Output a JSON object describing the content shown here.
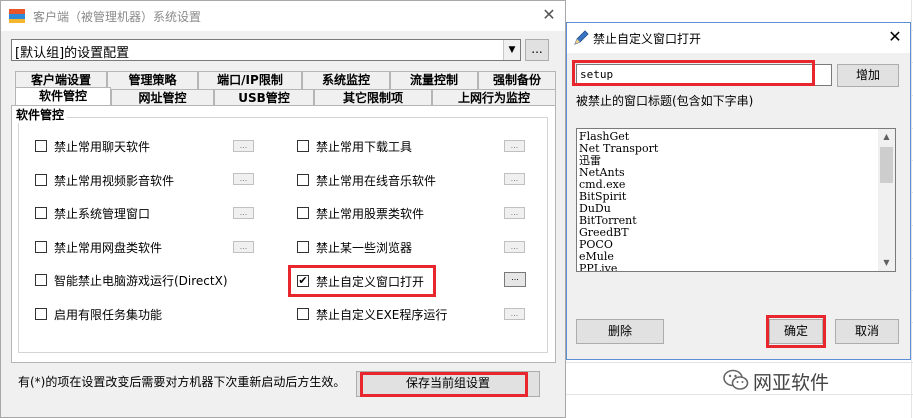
{
  "main_window": {
    "title": "客户端（被管理机器）系统设置",
    "close_glyph": "✕",
    "config_combo": {
      "value": "[默认组]的设置配置",
      "arrow": "▼"
    },
    "ellipsis_button": "...",
    "tabs_row1": [
      "客户端设置",
      "管理策略",
      "端口/IP限制",
      "系统监控",
      "流量控制",
      "强制备份"
    ],
    "tabs_row2": [
      "软件管控",
      "网址管控",
      "USB管控",
      "其它限制项",
      "上网行为监控"
    ],
    "active_tab": "软件管控",
    "group_title": "软件管控",
    "options_left": [
      {
        "label": "禁止常用聊天软件",
        "checked": false
      },
      {
        "label": "禁止常用视频影音软件",
        "checked": false
      },
      {
        "label": "禁止系统管理窗口",
        "checked": false
      },
      {
        "label": "禁止常用网盘类软件",
        "checked": false
      },
      {
        "label": "智能禁止电脑游戏运行(DirectX)",
        "checked": false
      },
      {
        "label": "启用有限任务集功能",
        "checked": false
      }
    ],
    "options_right": [
      {
        "label": "禁止常用下载工具",
        "checked": false
      },
      {
        "label": "禁止常用在线音乐软件",
        "checked": false
      },
      {
        "label": "禁止常用股票类软件",
        "checked": false
      },
      {
        "label": "禁止某一些浏览器",
        "checked": false
      },
      {
        "label": "禁止自定义窗口打开",
        "checked": true
      },
      {
        "label": "禁止自定义EXE程序运行",
        "checked": false
      }
    ],
    "mini_button_glyph": "...",
    "checkmark": "✔",
    "footnote": "有(*)的项在设置改变后需要对方机器下次重新启动后方生效。",
    "save_button": "保存当前组设置"
  },
  "dialog": {
    "title": "禁止自定义窗口打开",
    "close_glyph": "✕",
    "input_value": "setup",
    "add_button": "增加",
    "list_caption": "被禁止的窗口标题(包含如下字串)",
    "list_items": [
      "FlashGet",
      "Net Transport",
      "迅雷",
      "NetAnts",
      "cmd.exe",
      "BitSpirit",
      "DuDu",
      "BitTorrent",
      "GreedBT",
      "POCO",
      "eMule",
      "PPLive"
    ],
    "scroll_up": "▲",
    "scroll_down": "▼",
    "delete_button": "删除",
    "ok_button": "确定",
    "cancel_button": "取消"
  },
  "watermark": {
    "text": "网亚软件"
  },
  "colors": {
    "highlight_red": "#e8262e",
    "dialog_border": "#5b8fd6"
  }
}
